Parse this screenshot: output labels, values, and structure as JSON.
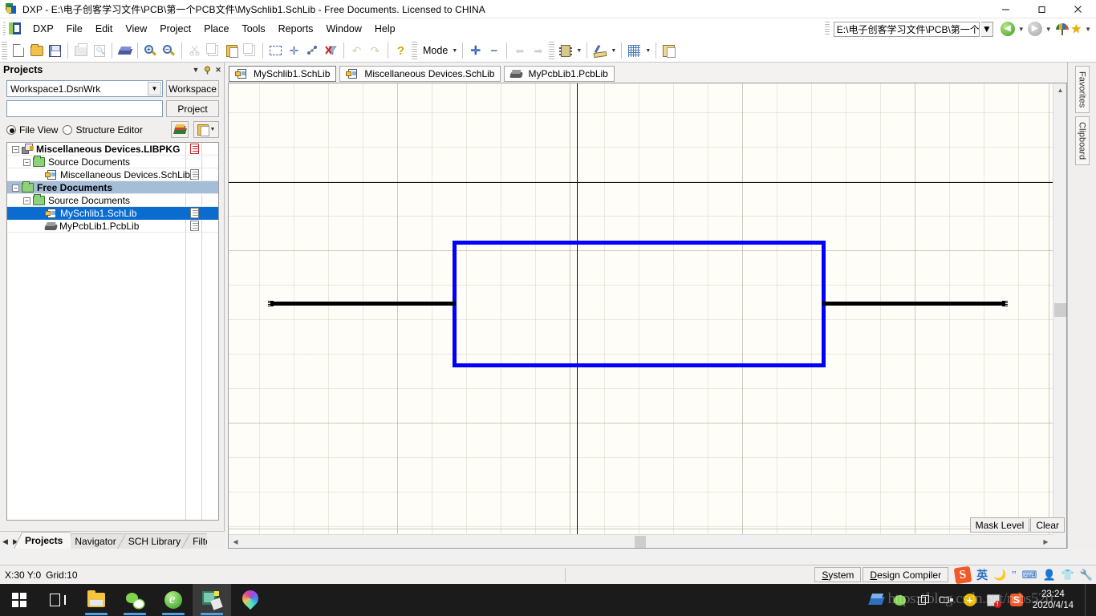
{
  "window": {
    "title": "DXP - E:\\电子创客学习文件\\PCB\\第一个PCB文件\\MySchlib1.SchLib - Free Documents. Licensed to CHINA",
    "app_icon": "altium-icon",
    "minimize": "—",
    "maximize": "❐",
    "close": "✕"
  },
  "menubar": {
    "items": [
      {
        "label": "DXP"
      },
      {
        "label": "File"
      },
      {
        "label": "Edit"
      },
      {
        "label": "View"
      },
      {
        "label": "Project"
      },
      {
        "label": "Place"
      },
      {
        "label": "Tools"
      },
      {
        "label": "Reports"
      },
      {
        "label": "Window"
      },
      {
        "label": "Help"
      }
    ],
    "path_value": "E:\\电子创客学习文件\\PCB\\第一个",
    "nav_back_icon": "back-arrow-icon",
    "nav_forward_icon": "forward-arrow-icon",
    "umbrella_icon": "umbrella-icon",
    "favorites_icon": "star-icon"
  },
  "toolbar": {
    "mode_label": "Mode",
    "buttons": [
      {
        "name": "new-document",
        "icon": "document-icon"
      },
      {
        "name": "open-document",
        "icon": "open-folder-icon"
      },
      {
        "name": "save-document",
        "icon": "floppy-disk-icon"
      },
      {
        "name": "print",
        "icon": "printer-icon"
      },
      {
        "name": "print-preview",
        "icon": "print-preview-icon"
      },
      {
        "name": "board-insight",
        "icon": "board-icon"
      },
      {
        "name": "zoom-in",
        "icon": "zoom-in-icon"
      },
      {
        "name": "zoom-out",
        "icon": "zoom-out-icon"
      },
      {
        "name": "cut",
        "icon": "scissors-icon"
      },
      {
        "name": "copy",
        "icon": "copy-icon"
      },
      {
        "name": "paste",
        "icon": "clipboard-icon"
      },
      {
        "name": "paste-array",
        "icon": "paste-array-icon"
      },
      {
        "name": "select-area",
        "icon": "rubber-band-select-icon"
      },
      {
        "name": "move-selection",
        "icon": "move-cross-icon"
      },
      {
        "name": "clear-selection",
        "icon": "deselect-icon"
      },
      {
        "name": "clear-filter",
        "icon": "clear-filter-icon"
      },
      {
        "name": "undo",
        "icon": "undo-arrow-icon"
      },
      {
        "name": "redo",
        "icon": "redo-arrow-icon"
      },
      {
        "name": "context-help",
        "icon": "question-mark-icon"
      },
      {
        "name": "add-component",
        "icon": "plus-icon"
      },
      {
        "name": "remove-component",
        "icon": "minus-icon"
      },
      {
        "name": "previous-part",
        "icon": "left-arrow-icon"
      },
      {
        "name": "next-part",
        "icon": "right-arrow-icon"
      },
      {
        "name": "component-properties",
        "icon": "chip-icon"
      },
      {
        "name": "drawing-tools",
        "icon": "ruler-pencil-icon"
      },
      {
        "name": "grid-settings",
        "icon": "grid-icon"
      },
      {
        "name": "workspace-panels",
        "icon": "panel-icon"
      }
    ]
  },
  "projects_panel": {
    "title": "Projects",
    "header_buttons": [
      "dropdown-icon",
      "pin-icon",
      "close-icon"
    ],
    "workspace_combo_value": "Workspace1.DsnWrk",
    "workspace_button": "Workspace",
    "project_field_value": "",
    "project_button": "Project",
    "file_view_label": "File View",
    "structure_editor_label": "Structure Editor",
    "file_view_selected": true,
    "tree": [
      {
        "depth": 0,
        "label": "Miscellaneous Devices.LIBPKG",
        "icon": "libpkg-icon",
        "bold": true,
        "expander": "−",
        "doc_icon": "red-sheet-icon",
        "state": "normal"
      },
      {
        "depth": 1,
        "label": "Source Documents",
        "icon": "folder-icon",
        "bold": false,
        "expander": "−",
        "doc_icon": "",
        "state": "normal"
      },
      {
        "depth": 2,
        "label": "Miscellaneous Devices.SchLib",
        "icon": "schlib-icon",
        "bold": false,
        "expander": "",
        "doc_icon": "grey-sheet-icon",
        "state": "normal"
      },
      {
        "depth": 0,
        "label": "Free Documents",
        "icon": "folder-icon",
        "bold": true,
        "expander": "−",
        "doc_icon": "",
        "state": "light-selected"
      },
      {
        "depth": 1,
        "label": "Source Documents",
        "icon": "folder-icon",
        "bold": false,
        "expander": "−",
        "doc_icon": "",
        "state": "normal"
      },
      {
        "depth": 2,
        "label": "MySchlib1.SchLib",
        "icon": "schlib-icon",
        "bold": false,
        "expander": "",
        "doc_icon": "grey-sheet-icon",
        "state": "selected"
      },
      {
        "depth": 2,
        "label": "MyPcbLib1.PcbLib",
        "icon": "pcblib-icon",
        "bold": false,
        "expander": "",
        "doc_icon": "grey-sheet-icon",
        "state": "normal"
      }
    ],
    "bottom_tabs": [
      {
        "label": "Projects",
        "active": true
      },
      {
        "label": "Navigator",
        "active": false
      },
      {
        "label": "SCH Library",
        "active": false
      },
      {
        "label": "Filter",
        "active": false
      }
    ]
  },
  "editor": {
    "document_tabs": [
      {
        "label": "MySchlib1.SchLib",
        "icon": "schlib-icon",
        "active": true
      },
      {
        "label": "Miscellaneous Devices.SchLib",
        "icon": "schlib-icon",
        "active": false
      },
      {
        "label": "MyPcbLib1.PcbLib",
        "icon": "pcblib-icon",
        "active": false
      }
    ],
    "mask_level_label": "Mask Level",
    "clear_label": "Clear",
    "schematic": {
      "symbol_outline_color": "#0000ff",
      "pin_color": "#000000",
      "canvas_color": "#fffdf7",
      "grid_color": "#beb4a5",
      "axis_color": "#111111"
    }
  },
  "right_dock": {
    "tabs": [
      {
        "label": "Favorites"
      },
      {
        "label": "Clipboard"
      }
    ]
  },
  "statusbar": {
    "coords": "X:30 Y:0",
    "grid": "Grid:10",
    "system_button": "System",
    "design_compiler_button": "Design Compiler",
    "ime": {
      "sogou_logo": "S",
      "lang_label": "英",
      "moon_icon": "moon-icon",
      "comma_icon": "punctuation-icon",
      "keyboard_icon": "keyboard-icon",
      "person_icon": "user-icon",
      "shirt_icon": "skin-icon",
      "wrench_icon": "tools-icon"
    }
  },
  "taskbar": {
    "apps": [
      {
        "name": "start-button",
        "icon": "windows-logo-icon",
        "active": false,
        "running": false
      },
      {
        "name": "task-view-button",
        "icon": "task-view-icon",
        "active": false,
        "running": false
      },
      {
        "name": "file-explorer",
        "icon": "folder-icon",
        "active": false,
        "running": true
      },
      {
        "name": "wechat",
        "icon": "wechat-icon",
        "active": false,
        "running": true
      },
      {
        "name": "browser-360",
        "icon": "browser-e-icon",
        "active": false,
        "running": true
      },
      {
        "name": "altium-designer",
        "icon": "altium-icon",
        "active": true,
        "running": true
      },
      {
        "name": "maps-app",
        "icon": "map-pin-icon",
        "active": false,
        "running": false
      }
    ],
    "tray": [
      {
        "name": "cloud-drive",
        "icon": "cube-icon"
      },
      {
        "name": "wechat-tray",
        "icon": "green-chat-icon"
      },
      {
        "name": "window-switch",
        "icon": "windows-square-icon"
      },
      {
        "name": "usb-device",
        "icon": "usb-icon"
      },
      {
        "name": "update-notice",
        "icon": "plus-circle-icon"
      },
      {
        "name": "image-tool",
        "icon": "picture-error-icon"
      },
      {
        "name": "sogou-ime",
        "icon": "sogou-s-icon"
      }
    ],
    "clock_time": "23:24",
    "clock_date": "2020/4/14",
    "watermark": "https://blog.csdn.net/mbs520"
  }
}
